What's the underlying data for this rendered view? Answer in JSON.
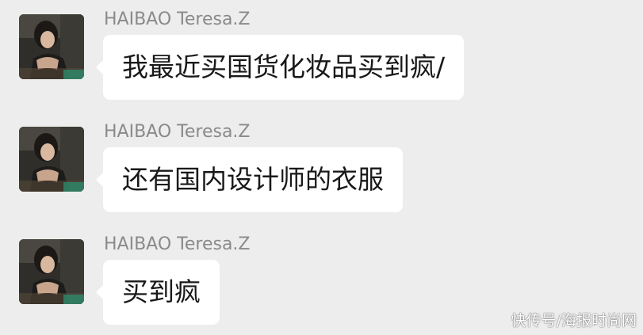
{
  "colors": {
    "background": "#ededed",
    "bubble": "#ffffff",
    "sender_name": "#8a8a8a",
    "message_text": "#191919"
  },
  "messages": [
    {
      "sender": "HAIBAO Teresa.Z",
      "avatar": "user-avatar-photo",
      "text": "我最近买国货化妆品买到疯/"
    },
    {
      "sender": "HAIBAO Teresa.Z",
      "avatar": "user-avatar-photo",
      "text": "还有国内设计师的衣服"
    },
    {
      "sender": "HAIBAO Teresa.Z",
      "avatar": "user-avatar-photo",
      "text": "买到疯"
    }
  ],
  "watermark": "快传号/海报时尚网"
}
